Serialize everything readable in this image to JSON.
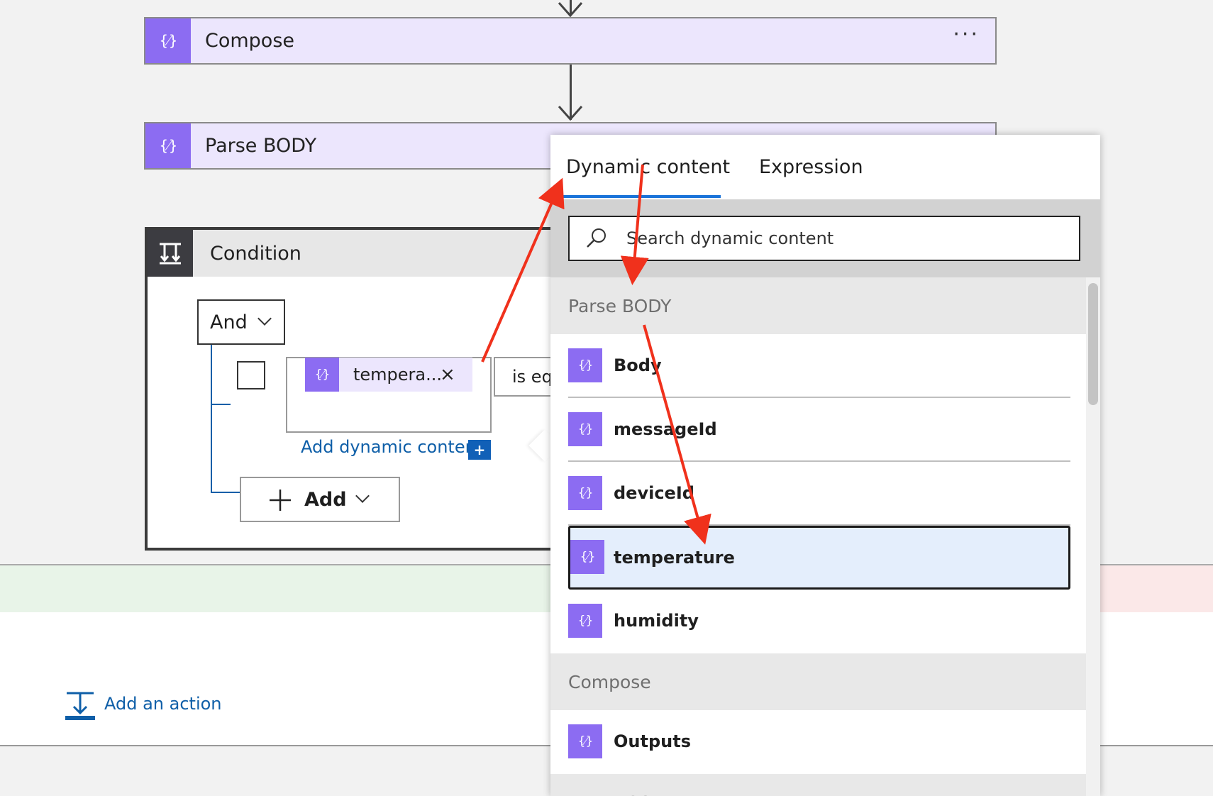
{
  "flow": {
    "compose": {
      "title": "Compose",
      "menu": "···"
    },
    "parse_body": {
      "title": "Parse BODY"
    },
    "condition": {
      "title": "Condition",
      "group_operator": "And",
      "token_label": "tempera...",
      "token_close": "×",
      "operator_text": "is equ",
      "add_dynamic_content": "Add dynamic content",
      "add_dynamic_plus": "+",
      "add_button": "Add"
    },
    "add_action": "Add an action"
  },
  "panel": {
    "tabs": [
      "Dynamic content",
      "Expression"
    ],
    "active_tab": "Dynamic content",
    "search_placeholder": "Search dynamic content",
    "groups": [
      {
        "name": "Parse BODY",
        "items": [
          "Body",
          "messageId",
          "deviceId",
          "temperature",
          "humidity"
        ]
      },
      {
        "name": "Compose",
        "items": [
          "Outputs"
        ]
      },
      {
        "name": "Parse JSON",
        "items": []
      }
    ],
    "selected_item": "temperature"
  },
  "icons": {
    "action": "braces-icon",
    "condition": "condition-icon",
    "search": "search-icon",
    "add": "plus-icon",
    "add_action": "add-action-icon"
  },
  "colors": {
    "action_accent": "#8c6cf2",
    "action_background": "#ece6fd",
    "link": "#0f5fa8",
    "tab_underline": "#1a73d9",
    "annotation_arrow": "#f0311c",
    "selected_item": "#e4eefc"
  }
}
